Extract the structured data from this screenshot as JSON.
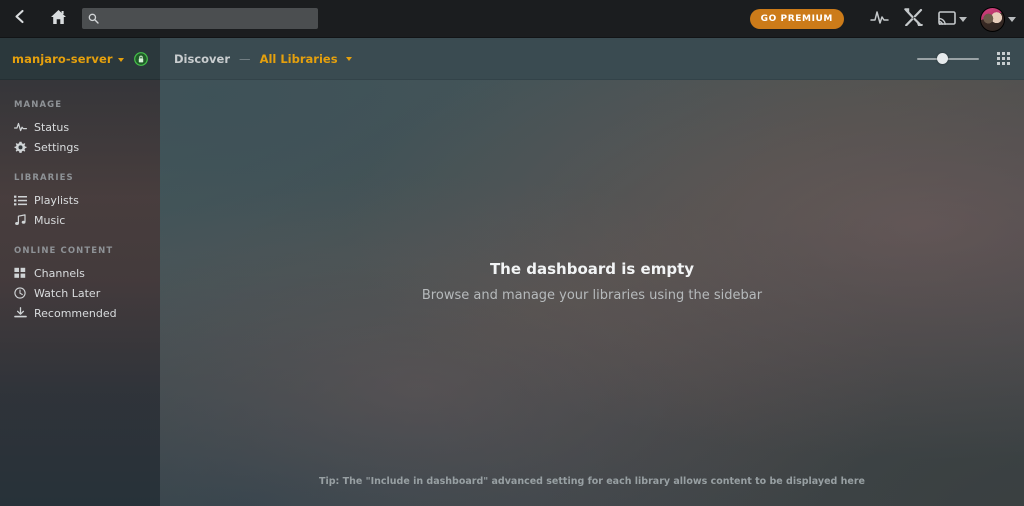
{
  "topbar": {
    "back_icon": "chevron-left-icon",
    "home_icon": "home-icon",
    "search": {
      "value": "",
      "placeholder": "",
      "icon": "search-icon"
    },
    "go_premium_label": "GO PREMIUM",
    "activity_icon": "activity-pulse-icon",
    "tools_icon": "wrench-screwdriver-icon",
    "cast_icon": "cast-screen-icon",
    "avatar_icon": "user-avatar"
  },
  "sidebar": {
    "server_name": "manjaro-server",
    "secure_icon": "green-lock-badge-icon",
    "sections": [
      {
        "label": "MANAGE",
        "items": [
          {
            "label": "Status",
            "icon": "activity-pulse-icon"
          },
          {
            "label": "Settings",
            "icon": "gear-icon"
          }
        ]
      },
      {
        "label": "LIBRARIES",
        "items": [
          {
            "label": "Playlists",
            "icon": "list-icon"
          },
          {
            "label": "Music",
            "icon": "music-note-icon"
          }
        ]
      },
      {
        "label": "ONLINE CONTENT",
        "items": [
          {
            "label": "Channels",
            "icon": "grid-squares-icon"
          },
          {
            "label": "Watch Later",
            "icon": "clock-icon"
          },
          {
            "label": "Recommended",
            "icon": "download-tray-icon"
          }
        ]
      }
    ]
  },
  "content": {
    "breadcrumb": {
      "root": "Discover",
      "separator": "—",
      "current": "All Libraries"
    },
    "view_controls": {
      "slider_icon": "size-slider",
      "grid_icon": "grid-view-icon"
    },
    "empty_state": {
      "title": "The dashboard is empty",
      "subtitle": "Browse and manage your libraries using the sidebar"
    },
    "tip": "Tip: The \"Include in dashboard\" advanced setting for each library allows content to be displayed here"
  },
  "colors": {
    "accent_gold": "#e5a00d",
    "premium_orange": "#cc7b19",
    "secure_green": "#3fa13f",
    "topbar_bg": "#1b1d1f",
    "header_bg": "#3a4b51"
  }
}
